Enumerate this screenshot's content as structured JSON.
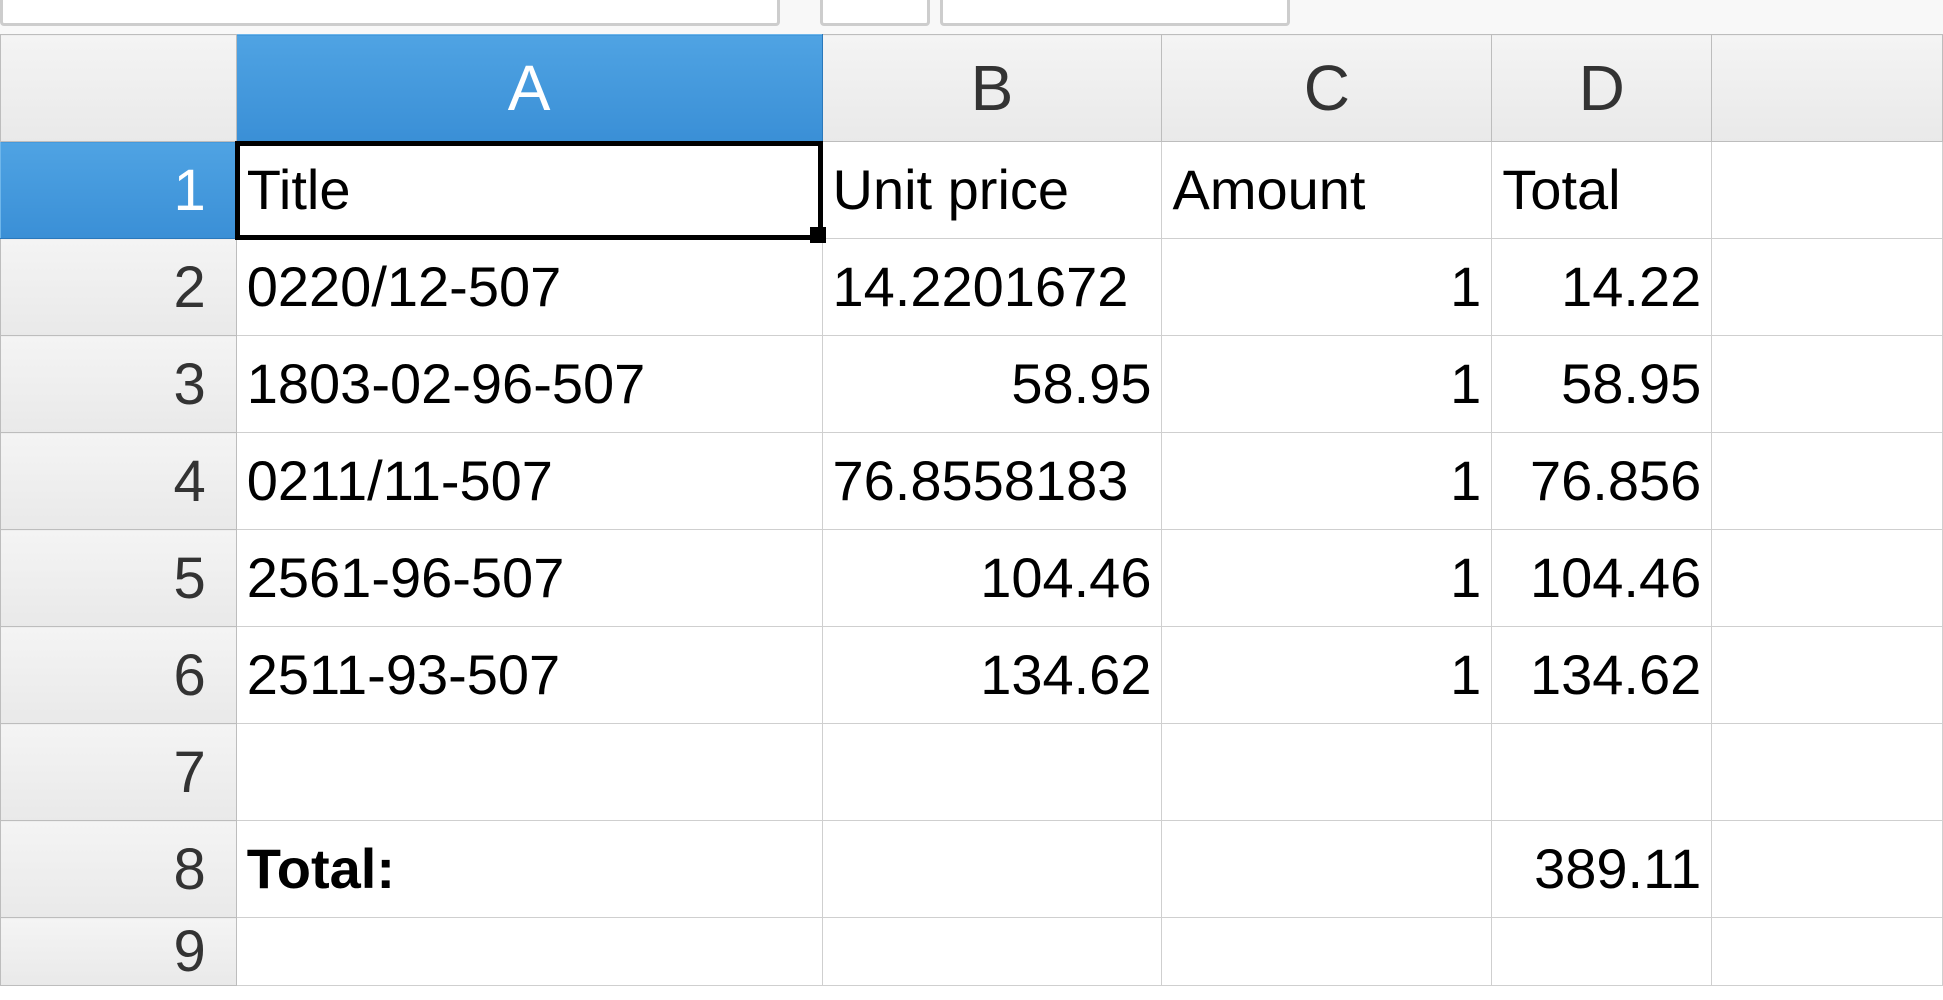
{
  "columns": {
    "A": "A",
    "B": "B",
    "C": "C",
    "D": "D"
  },
  "row_numbers": [
    "1",
    "2",
    "3",
    "4",
    "5",
    "6",
    "7",
    "8",
    "9"
  ],
  "headers": {
    "title": "Title",
    "unit_price": "Unit price",
    "amount": "Amount",
    "total": "Total"
  },
  "rows": [
    {
      "title": "0220/12-507",
      "unit_price": "14.2201672",
      "amount": "1",
      "total": "14.22"
    },
    {
      "title": "1803-02-96-507",
      "unit_price": "58.95",
      "amount": "1",
      "total": "58.95"
    },
    {
      "title": "0211/11-507",
      "unit_price": "76.8558183",
      "amount": "1",
      "total": "76.856"
    },
    {
      "title": "2561-96-507",
      "unit_price": "104.46",
      "amount": "1",
      "total": "104.46"
    },
    {
      "title": "2511-93-507",
      "unit_price": "134.62",
      "amount": "1",
      "total": "134.62"
    }
  ],
  "summary": {
    "label": "Total:",
    "value": "389.11"
  },
  "active_cell": "A1",
  "chart_data": {
    "type": "table",
    "columns": [
      "Title",
      "Unit price",
      "Amount",
      "Total"
    ],
    "rows": [
      [
        "0220/12-507",
        14.2201672,
        1,
        14.22
      ],
      [
        "1803-02-96-507",
        58.95,
        1,
        58.95
      ],
      [
        "0211/11-507",
        76.8558183,
        1,
        76.856
      ],
      [
        "2561-96-507",
        104.46,
        1,
        104.46
      ],
      [
        "2511-93-507",
        134.62,
        1,
        134.62
      ]
    ],
    "total": 389.11
  }
}
